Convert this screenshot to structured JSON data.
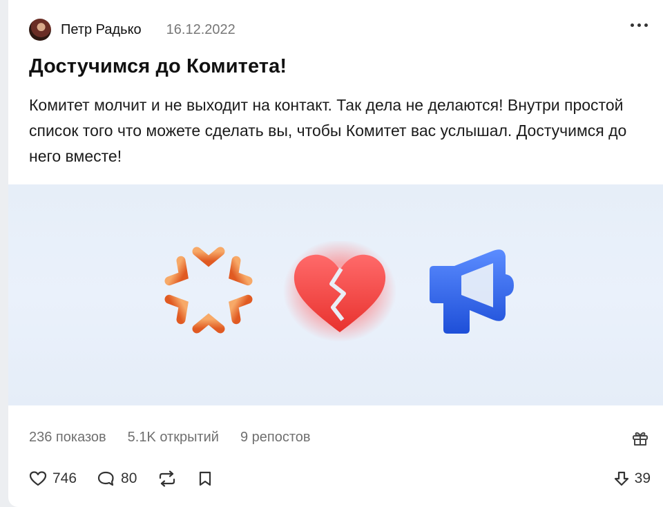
{
  "post": {
    "author": "Петр Радько",
    "date": "16.12.2022",
    "title": "Достучимся до Комитета!",
    "body": "Комитет молчит и не выходит на контакт. Так дела не делаются! Внутри простой список того что можете сделать вы, чтобы Комитет вас услышал. Достучимся до него вместе!"
  },
  "banner": {
    "icons": [
      "snowflake-icon",
      "broken-heart-icon",
      "megaphone-icon"
    ],
    "colors": {
      "snowflake": "#ea7a3a",
      "heart": "#f04040",
      "megaphone": "#3a6ef0",
      "background": "#e8f0fa"
    }
  },
  "stats": {
    "views": "236 показов",
    "opens": "5.1K открытий",
    "reposts": "9 репостов"
  },
  "actions": {
    "likes": "746",
    "comments": "80",
    "dislikes": "39"
  }
}
